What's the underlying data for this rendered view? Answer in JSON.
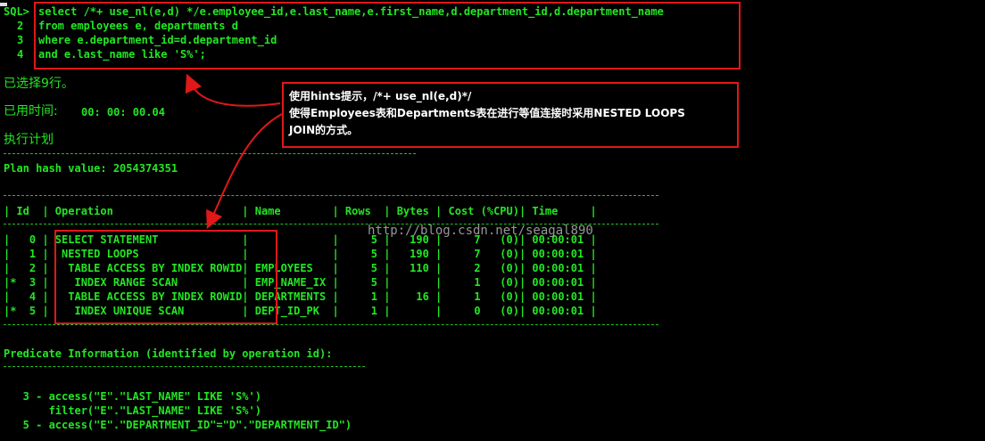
{
  "sql": {
    "prompt": "SQL>",
    "lines": [
      {
        "num": "",
        "text": "select /*+ use_nl(e,d) */e.employee_id,e.last_name,e.first_name,d.department_id,d.department_name"
      },
      {
        "num": "2",
        "text": "from employees e, departments d"
      },
      {
        "num": "3",
        "text": "where e.department_id=d.department_id"
      },
      {
        "num": "4",
        "text": "and e.last_name like 'S%';"
      }
    ]
  },
  "rows_selected": "已选择9行。",
  "elapsed": {
    "label": "已用时间:",
    "value": "00: 00: 00.04"
  },
  "plan_title": "执行计划",
  "plan_hash": "Plan hash value: 2054374351",
  "note": {
    "lines": [
      "使用hints提示，/*+ use_nl(e,d)*/",
      "使得Employees表和Departments表在进行等值连接时采用NESTED LOOPS",
      "JOIN的方式。"
    ]
  },
  "table": {
    "header": "| Id  | Operation                    | Name        | Rows  | Bytes | Cost (%CPU)| Time     |",
    "rows": [
      "|   0 | SELECT STATEMENT             |             |     5 |   190 |     7   (0)| 00:00:01 |",
      "|   1 |  NESTED LOOPS                |             |     5 |   190 |     7   (0)| 00:00:01 |",
      "|   2 |   TABLE ACCESS BY INDEX ROWID| EMPLOYEES   |     5 |   110 |     2   (0)| 00:00:01 |",
      "|*  3 |    INDEX RANGE SCAN          | EMP_NAME_IX |     5 |       |     1   (0)| 00:00:01 |",
      "|   4 |   TABLE ACCESS BY INDEX ROWID| DEPARTMENTS |     1 |    16 |     1   (0)| 00:00:01 |",
      "|*  5 |    INDEX UNIQUE SCAN         | DEPT_ID_PK  |     1 |       |     0   (0)| 00:00:01 |"
    ]
  },
  "watermark": "http://blog.csdn.net/seagal890",
  "predicate": {
    "title": "Predicate Information (identified by operation id):",
    "lines": [
      "   3 - access(\"E\".\"LAST_NAME\" LIKE 'S%')",
      "       filter(\"E\".\"LAST_NAME\" LIKE 'S%')",
      "   5 - access(\"E\".\"DEPARTMENT_ID\"=\"D\".\"DEPARTMENT_ID\")"
    ]
  },
  "colors": {
    "text": "#22e622",
    "highlight": "#e01818",
    "background": "#000000"
  }
}
